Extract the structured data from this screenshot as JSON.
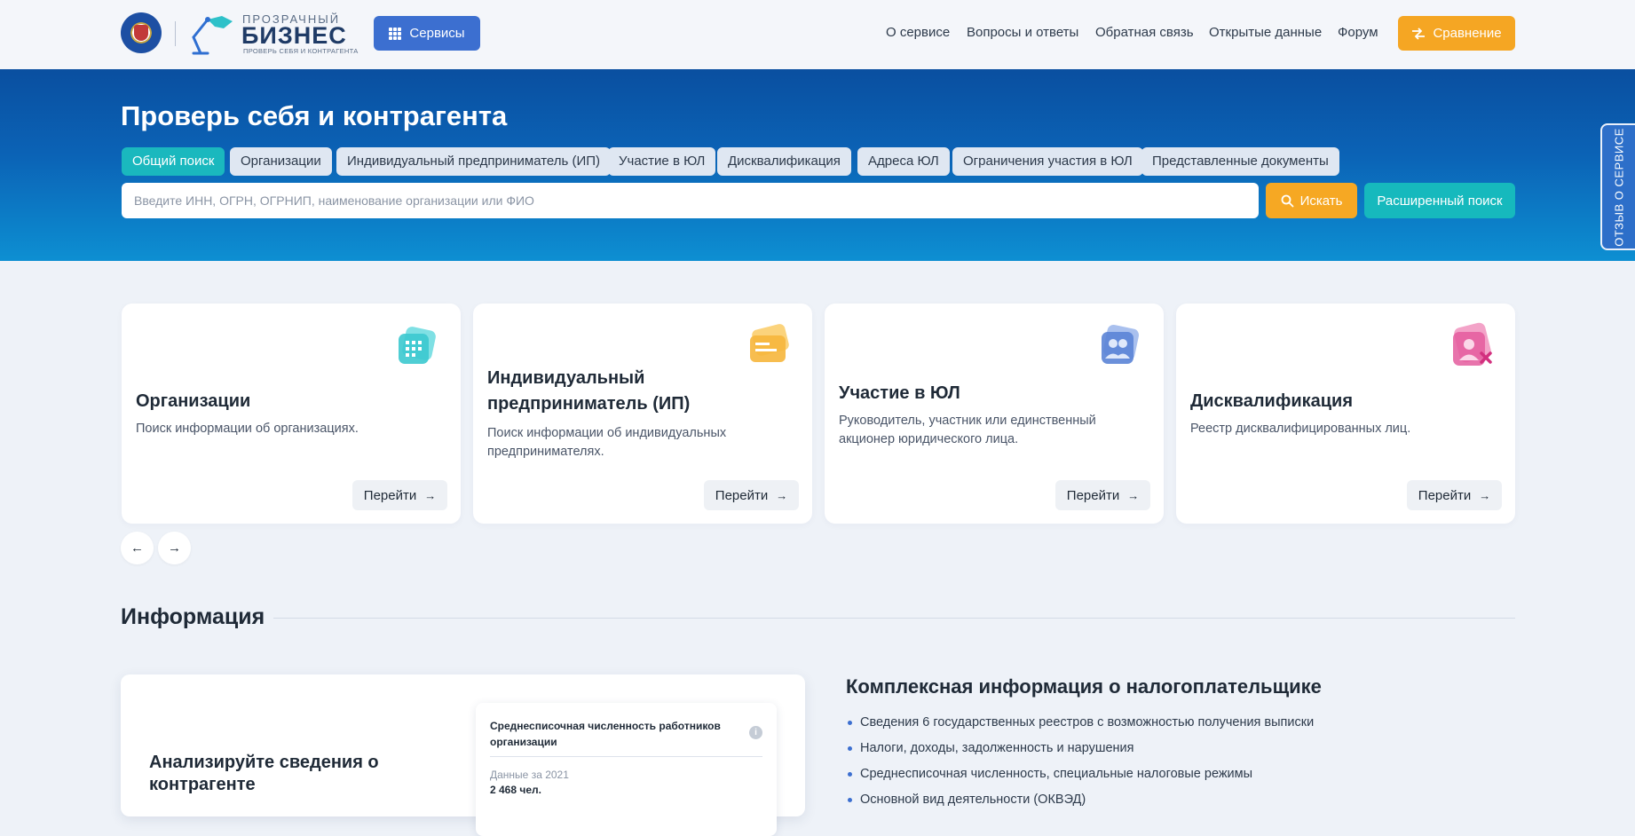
{
  "header": {
    "logo": {
      "top_text": "ПРОЗРАЧНЫЙ",
      "main_text": "БИЗНЕС",
      "sub_text": "ПРОВЕРЬ СЕБЯ И КОНТРАГЕНТА"
    },
    "services_label": "Сервисы",
    "nav": [
      "О сервисе",
      "Вопросы и ответы",
      "Обратная связь",
      "Открытые данные",
      "Форум"
    ],
    "compare_label": "Сравнение"
  },
  "hero": {
    "title": "Проверь себя и контрагента",
    "tabs": [
      {
        "label": "Общий поиск",
        "active": true
      },
      {
        "label": "Организации",
        "active": false
      },
      {
        "label": "Индивидуальный предприниматель (ИП)",
        "active": false
      },
      {
        "label": "Участие в ЮЛ",
        "active": false
      },
      {
        "label": "Дисквалификация",
        "active": false
      },
      {
        "label": "Адреса ЮЛ",
        "active": false
      },
      {
        "label": "Ограничения участия в ЮЛ",
        "active": false
      },
      {
        "label": "Представленные документы",
        "active": false
      }
    ],
    "search_placeholder": "Введите ИНН, ОГРН, ОГРНИП, наименование организации или ФИО",
    "search_value": "",
    "search_button": "Искать",
    "advanced_button": "Расширенный поиск",
    "feedback_tab": "ОТЗЫВ О СЕРВИСЕ"
  },
  "cards": [
    {
      "title": "Организации",
      "desc": "Поиск информации об организациях.",
      "button": "Перейти",
      "icon": "building-icon",
      "color": "#3cc9cf"
    },
    {
      "title": "Индивидуальный предприниматель (ИП)",
      "desc": "Поиск информации об индивидуальных предпринимателях.",
      "button": "Перейти",
      "icon": "id-card-icon",
      "color": "#f6b63c"
    },
    {
      "title": "Участие в ЮЛ",
      "desc": "Руководитель, участник или единственный акционер юридического лица.",
      "button": "Перейти",
      "icon": "people-icon",
      "color": "#5b84d6"
    },
    {
      "title": "Дисквалификация",
      "desc": "Реестр дисквалифицированных лиц.",
      "button": "Перейти",
      "icon": "person-remove-icon",
      "color": "#e45c9d"
    }
  ],
  "info": {
    "title": "Информация",
    "analyze_title": "Анализируйте сведения о контрагенте",
    "mini_card": {
      "title": "Среднесписочная численность работников организации",
      "period": "Данные за 2021",
      "value": "2 468 чел."
    },
    "complex_title": "Комплексная информация о налогоплательщике",
    "features": [
      "Сведения 6 государственных реестров с возможностью получения выписки",
      "Налоги, доходы, задолженность и нарушения",
      "Среднесписочная численность, специальные налоговые режимы",
      "Основной вид деятельности (ОКВЭД)"
    ]
  },
  "colors": {
    "accent_blue": "#3c6fd0",
    "accent_orange": "#f6a823",
    "accent_teal": "#16b9bd",
    "hero_top": "#0a4fa0",
    "hero_bottom": "#0d8fd2"
  }
}
